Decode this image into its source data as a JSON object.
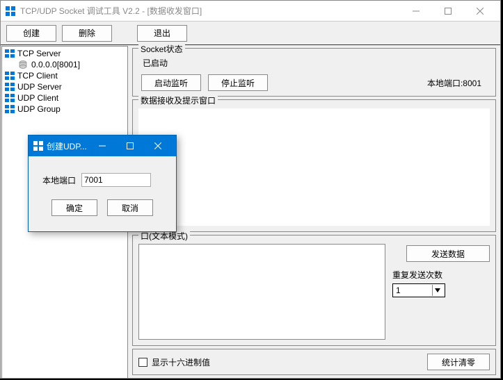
{
  "window": {
    "title": "TCP/UDP Socket 调试工具 V2.2 - [数据收发窗口]"
  },
  "toolbar": {
    "create_label": "创建",
    "delete_label": "删除",
    "exit_label": "退出"
  },
  "tree": {
    "items": [
      {
        "label": "TCP Server",
        "type": "root"
      },
      {
        "label": "0.0.0.0[8001]",
        "type": "child"
      },
      {
        "label": "TCP Client",
        "type": "root"
      },
      {
        "label": "UDP Server",
        "type": "root"
      },
      {
        "label": "UDP Client",
        "type": "root"
      },
      {
        "label": "UDP Group",
        "type": "root"
      }
    ]
  },
  "status": {
    "title": "Socket状态",
    "state_text": "已启动",
    "start_label": "启动监听",
    "stop_label": "停止监听",
    "port_label": "本地端口:8001"
  },
  "recv": {
    "title": "数据接收及提示窗口"
  },
  "send": {
    "title": "口(文本模式)",
    "send_label": "发送数据",
    "repeat_label": "重复发送次数",
    "repeat_value": "1"
  },
  "footer": {
    "hex_label": "显示十六进制值",
    "stats_label": "统计清零"
  },
  "dialog": {
    "title": "创建UDP...",
    "port_label": "本地端口",
    "port_value": "7001",
    "ok_label": "确定",
    "cancel_label": "取消"
  }
}
